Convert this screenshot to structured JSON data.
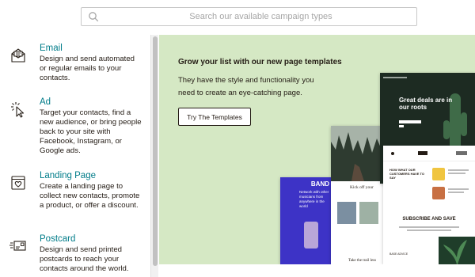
{
  "search": {
    "placeholder": "Search our available campaign types"
  },
  "sidebar": {
    "items": [
      {
        "title": "Email",
        "description": "Design and send automated or regular emails to your contacts.",
        "icon": "envelope-icon"
      },
      {
        "title": "Ad",
        "description": "Target your contacts, find a new audience, or bring people back to your site with Facebook, Instagram, or Google ads.",
        "icon": "cursor-click-icon"
      },
      {
        "title": "Landing Page",
        "description": "Create a landing page to collect new contacts, promote a product, or offer a discount.",
        "icon": "heart-page-icon"
      },
      {
        "title": "Postcard",
        "description": "Design and send printed postcards to reach your contacts around the world.",
        "icon": "postcard-icon"
      }
    ]
  },
  "main": {
    "headline": "Grow your list with our new page templates",
    "subtext_line1": "They have the style and functionality you",
    "subtext_line2": "need to create an eye-catching page.",
    "cta_label": "Try The Templates",
    "background_color": "#d5e8c4"
  },
  "mockups": {
    "dark_heading": "Great deals are in our roots",
    "blue_band": "BAND",
    "blue_text": "Network with other musicians from anywhere in the world",
    "photo_caption": "Kick off your",
    "photo_caption2": "Take the trail less",
    "white_heading": "HOW WHAT OUR CUSTOMERS HAVE TO SAY",
    "subscribe": "SUBSCRIBE AND SAVE",
    "base_advice": "BASE ADVICE"
  },
  "colors": {
    "accent": "#007c89",
    "text": "#241c15"
  }
}
